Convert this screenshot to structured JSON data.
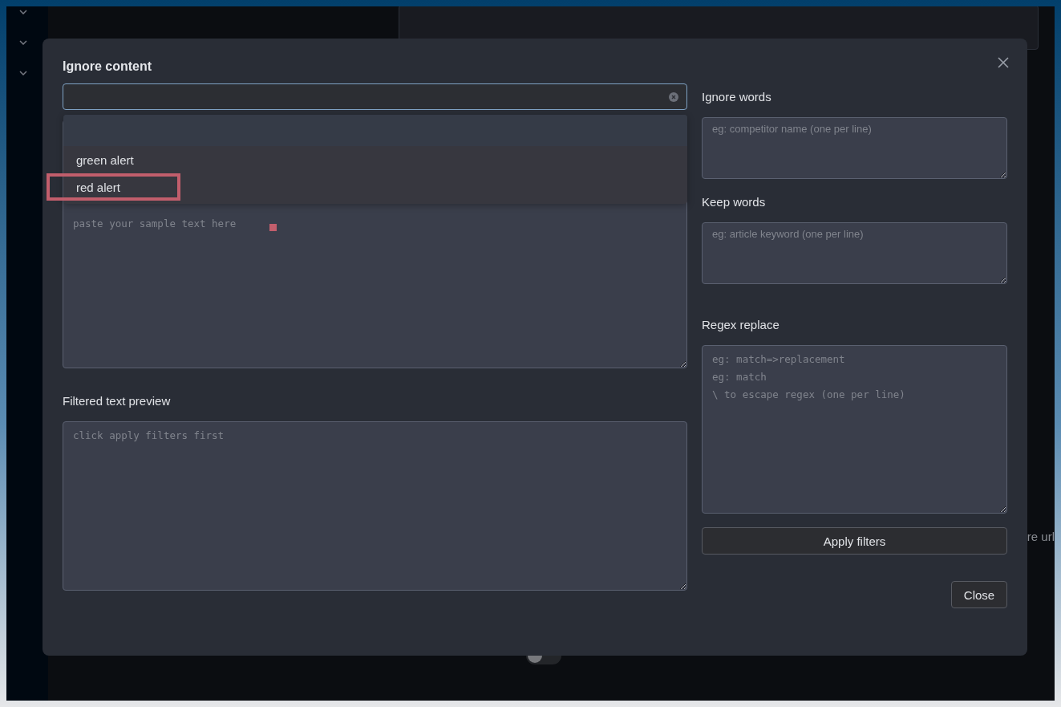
{
  "background": {
    "right_text": "re url",
    "toggle": {
      "on": false
    }
  },
  "dialog": {
    "title": "Ignore content",
    "options": [
      {
        "label": "green alert",
        "outlined": false
      },
      {
        "label": "red alert",
        "outlined": true
      }
    ],
    "sample": {
      "placeholder": "paste your sample text here"
    },
    "preview": {
      "label": "Filtered text preview",
      "placeholder": "click apply filters first"
    },
    "ignore_words": {
      "label": "Ignore words",
      "placeholder": "eg: competitor name (one per line)"
    },
    "keep_words": {
      "label": "Keep words",
      "placeholder": "eg: article keyword (one per line)"
    },
    "regex": {
      "label": "Regex replace",
      "placeholder": "eg: match=>replacement\neg: match\n\\ to escape regex (one per line)"
    },
    "apply_button": "Apply filters",
    "close_button": "Close"
  }
}
